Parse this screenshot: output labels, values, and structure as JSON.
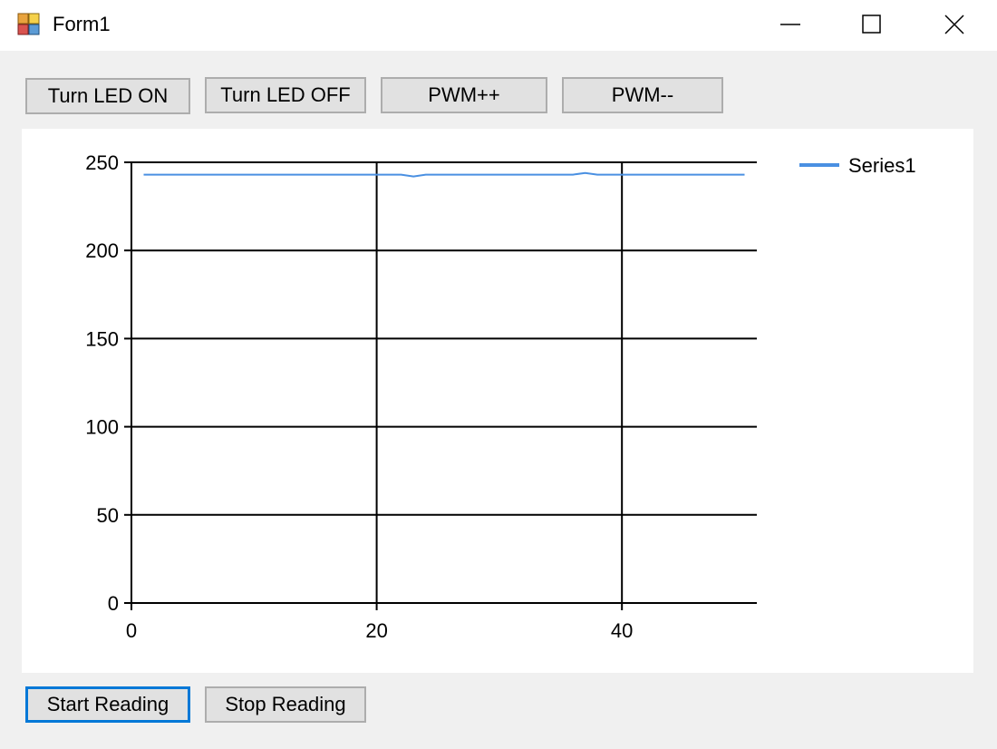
{
  "window": {
    "title": "Form1",
    "controls": {
      "minimize": "minimize-icon",
      "maximize": "maximize-icon",
      "close": "close-icon"
    }
  },
  "toolbar": {
    "led_on": "Turn LED ON",
    "led_off": "Turn LED OFF",
    "pwm_up": "PWM++",
    "pwm_down": "PWM--"
  },
  "footer": {
    "start": "Start Reading",
    "stop": "Stop Reading"
  },
  "colors": {
    "series": "#4a90e2",
    "focus": "#0078d7"
  },
  "chart_data": {
    "type": "line",
    "xlim": [
      0,
      51
    ],
    "ylim": [
      0,
      250
    ],
    "xticks": [
      0,
      20,
      40
    ],
    "yticks": [
      0,
      50,
      100,
      150,
      200,
      250
    ],
    "grid": true,
    "legend_position": "top-right",
    "series": [
      {
        "name": "Series1",
        "x": [
          1,
          2,
          3,
          4,
          5,
          6,
          7,
          8,
          9,
          10,
          11,
          12,
          13,
          14,
          15,
          16,
          17,
          18,
          19,
          20,
          21,
          22,
          23,
          24,
          25,
          26,
          27,
          28,
          29,
          30,
          31,
          32,
          33,
          34,
          35,
          36,
          37,
          38,
          39,
          40,
          41,
          42,
          43,
          44,
          45,
          46,
          47,
          48,
          49,
          50
        ],
        "y": [
          243,
          243,
          243,
          243,
          243,
          243,
          243,
          243,
          243,
          243,
          243,
          243,
          243,
          243,
          243,
          243,
          243,
          243,
          243,
          243,
          243,
          243,
          242,
          243,
          243,
          243,
          243,
          243,
          243,
          243,
          243,
          243,
          243,
          243,
          243,
          243,
          244,
          243,
          243,
          243,
          243,
          243,
          243,
          243,
          243,
          243,
          243,
          243,
          243,
          243
        ]
      }
    ]
  }
}
